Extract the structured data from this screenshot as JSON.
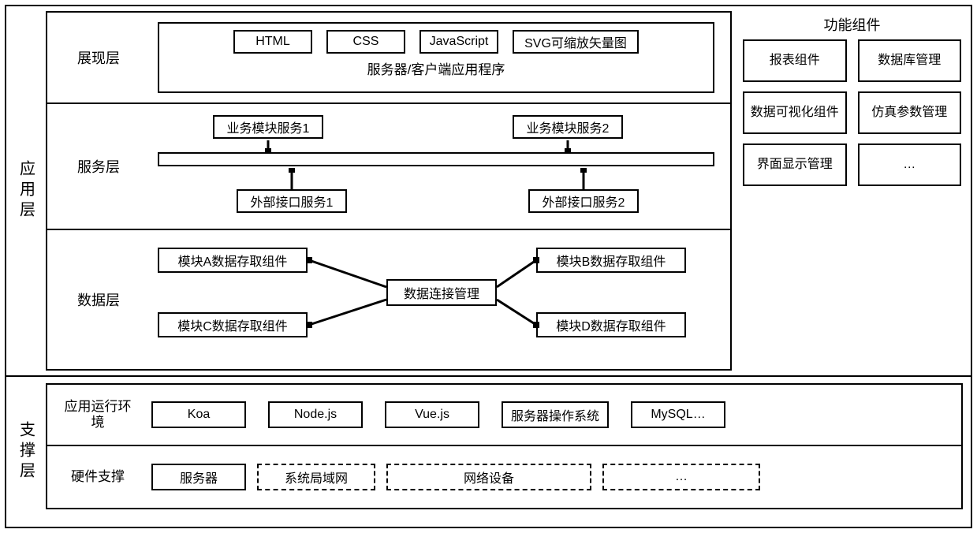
{
  "layers": {
    "app": {
      "label": "应用层",
      "presentation": {
        "label": "展现层",
        "items": [
          "HTML",
          "CSS",
          "JavaScript",
          "SVG可缩放矢量图"
        ],
        "caption": "服务器/客户端应用程序"
      },
      "service": {
        "label": "服务层",
        "top": [
          "业务模块服务1",
          "业务模块服务2"
        ],
        "bottom": [
          "外部接口服务1",
          "外部接口服务2"
        ]
      },
      "data": {
        "label": "数据层",
        "center": "数据连接管理",
        "left": [
          "模块A数据存取组件",
          "模块C数据存取组件"
        ],
        "right": [
          "模块B数据存取组件",
          "模块D数据存取组件"
        ]
      }
    },
    "components": {
      "title": "功能组件",
      "items": [
        "报表组件",
        "数据库管理",
        "数据可视化组件",
        "仿真参数管理",
        "界面显示管理",
        "…"
      ]
    },
    "support": {
      "label": "支撑层",
      "runtime": {
        "label": "应用运行环境",
        "items": [
          "Koa",
          "Node.js",
          "Vue.js",
          "服务器操作系统",
          "MySQL…"
        ]
      },
      "hardware": {
        "label": "硬件支撑",
        "items": [
          {
            "text": "服务器",
            "dashed": false
          },
          {
            "text": "系统局域网",
            "dashed": true
          },
          {
            "text": "网络设备",
            "dashed": true
          },
          {
            "text": "…",
            "dashed": true
          }
        ]
      }
    }
  }
}
